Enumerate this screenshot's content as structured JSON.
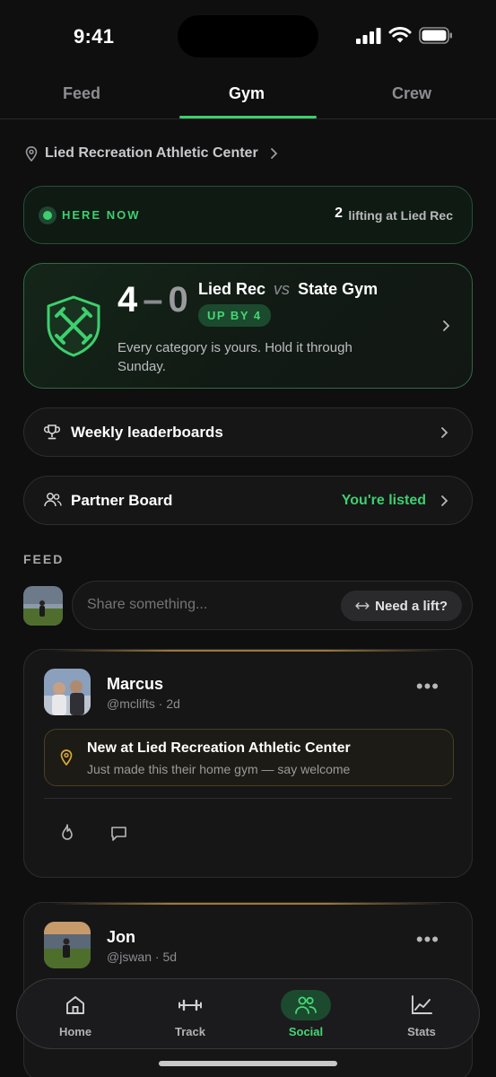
{
  "status_bar": {
    "time": "9:41"
  },
  "top_tabs": [
    {
      "label": "Feed",
      "active": false
    },
    {
      "label": "Gym",
      "active": true
    },
    {
      "label": "Crew",
      "active": false
    }
  ],
  "location": {
    "name": "Lied Recreation Athletic Center",
    "icon": "map-pin-icon"
  },
  "here_now": {
    "label": "HERE NOW",
    "count": "2",
    "sub": "lifting at Lied Rec"
  },
  "battle": {
    "score_home": "4",
    "score_away": "0",
    "home": "Lied Rec",
    "vs": "vs",
    "away": "State Gym",
    "badge": "UP BY 4",
    "description": "Every category is yours. Hold it through Sunday."
  },
  "leaderboards": {
    "label": "Weekly leaderboards",
    "icon": "trophy-icon"
  },
  "partner_board": {
    "label": "Partner Board",
    "status": "You're listed",
    "icon": "people-icon"
  },
  "feed": {
    "header": "FEED",
    "composer_placeholder": "Share something...",
    "need_lift": "Need a lift?"
  },
  "posts": [
    {
      "name": "Marcus",
      "meta": "@mclifts · 2d",
      "event_title": "New at Lied Recreation Athletic Center",
      "event_sub": "Just made this their home gym — say welcome"
    },
    {
      "name": "Jon",
      "meta": "@jswan · 5d"
    }
  ],
  "bottom_nav": [
    {
      "label": "Home",
      "icon": "home-icon",
      "active": false
    },
    {
      "label": "Track",
      "icon": "dumbbell-icon",
      "active": false
    },
    {
      "label": "Social",
      "icon": "social-icon",
      "active": true
    },
    {
      "label": "Stats",
      "icon": "chart-icon",
      "active": false
    }
  ],
  "colors": {
    "accent": "#3ecf6e",
    "gold": "#c9a23a",
    "background": "#0f0f10"
  }
}
